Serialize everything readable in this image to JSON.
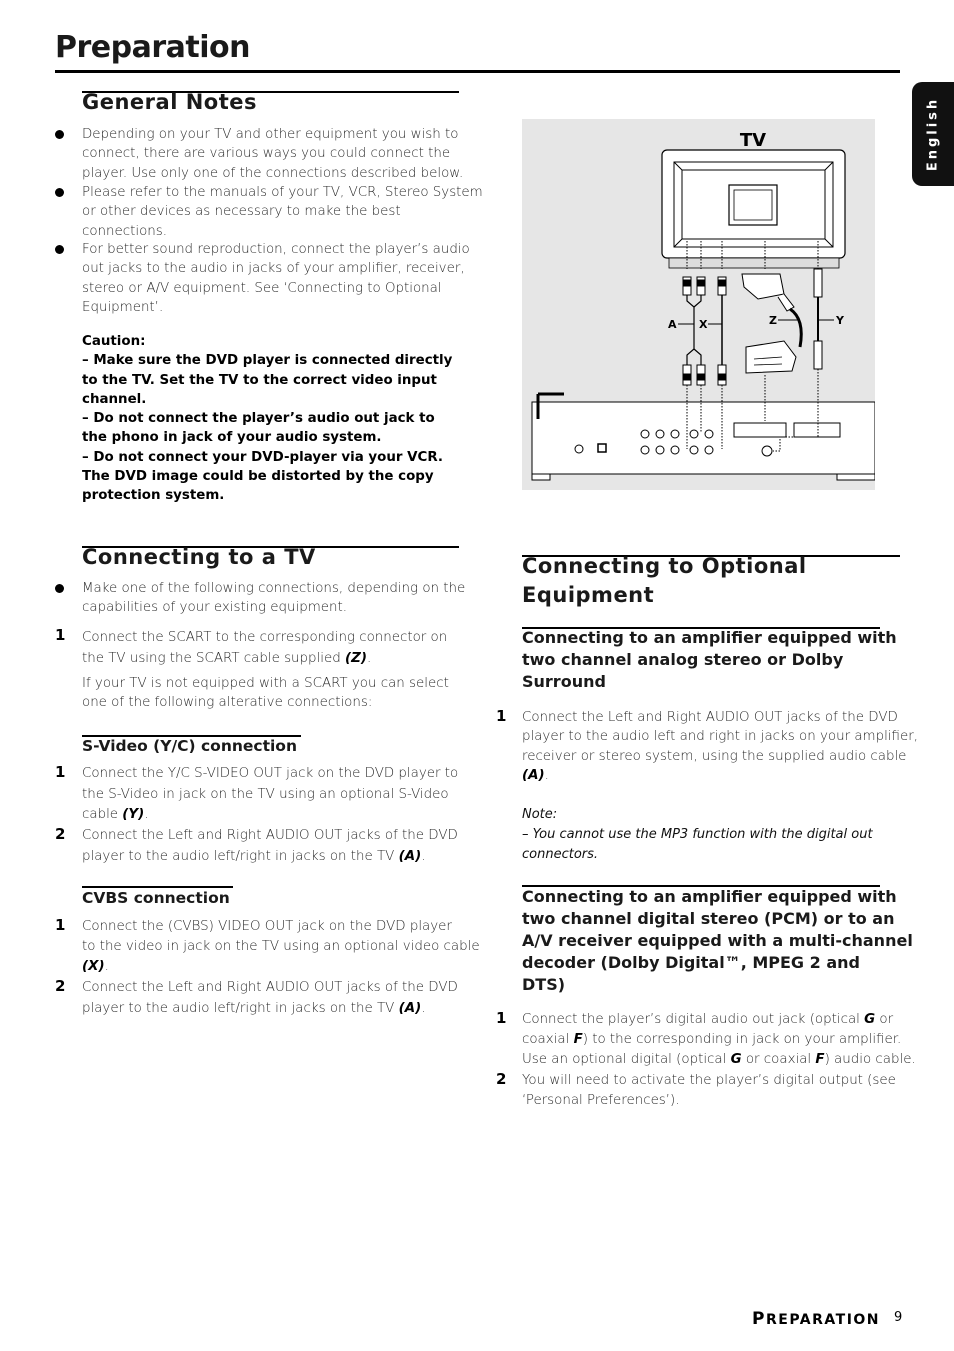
{
  "page": {
    "title": "Preparation",
    "language_tab": "English",
    "footer_section_first": "P",
    "footer_section_rest": "REPARATION",
    "page_number": "9"
  },
  "general_notes": {
    "heading": "General Notes",
    "bullets": [
      [
        "Depending on your TV and other equipment you wish to",
        "connect, there are various ways you could connect the",
        "player. Use only one of the connections described below."
      ],
      [
        "Please refer to the manuals of your TV, VCR, Stereo System",
        "or other devices as necessary to make the best",
        "connections."
      ],
      [
        "For better sound reproduction, connect the player’s audio",
        "out jacks to the audio in jacks of your amplifier, receiver,",
        "stereo or A/V equipment.  See ‘Connecting to Optional",
        "Equipment’."
      ]
    ],
    "caution_label": "Caution:",
    "caution_lines": [
      "– Make sure the DVD player is connected directly",
      "to the TV. Set the TV to the correct video input",
      "channel.",
      "–  Do not connect  the player’s audio out jack to",
      "the phono in jack of your audio system.",
      "–  Do not connect your DVD-player via your VCR.",
      "The DVD image could be distorted by the copy",
      "protection system."
    ]
  },
  "diagram": {
    "tv_label": "TV",
    "cable_labels": {
      "a": "A",
      "x": "X",
      "z": "Z",
      "y": "Y"
    }
  },
  "connecting_tv": {
    "heading": "Connecting to a TV",
    "bullet": [
      "Make one of the following connections, depending on the",
      "capabilities of your existing equipment."
    ],
    "step1_num": "1",
    "step1_lines": [
      "Connect the SCART to the corresponding connector on",
      "the TV using the SCART cable supplied "
    ],
    "step1_ref": "(Z)",
    "alt_lines": [
      "If your TV is not equipped with a SCART you can select",
      "one of the following alterative connections:"
    ],
    "svideo": {
      "heading": "S-Video (Y/C) connection",
      "step1_num": "1",
      "step1_lines": [
        "Connect the Y/C S-VIDEO OUT jack on the DVD player to",
        "the S-Video in jack on the TV using an optional S-Video",
        "cable "
      ],
      "step1_ref": "(Y)",
      "step2_num": "2",
      "step2_lines": [
        "Connect the Left and Right AUDIO OUT jacks of the DVD",
        "player to the audio left/right in jacks on the TV "
      ],
      "step2_ref": "(A)"
    },
    "cvbs": {
      "heading": "CVBS connection",
      "step1_num": "1",
      "step1_lines": [
        "Connect the (CVBS) VIDEO OUT jack on the DVD player",
        "to the video in jack on the TV using an optional video cable"
      ],
      "step1_ref": "(X)",
      "step2_num": "2",
      "step2_lines": [
        "Connect the Left and Right AUDIO OUT jacks of the DVD",
        "player to the audio left/right in jacks on the TV "
      ],
      "step2_ref": "(A)"
    }
  },
  "optional_equipment": {
    "heading_lines": [
      "Connecting to Optional",
      "Equipment"
    ],
    "analog": {
      "heading_lines": [
        "Connecting to an amplifier equipped with",
        "two channel analog  stereo or Dolby",
        "Surround"
      ],
      "step1_num": "1",
      "step1_lines": [
        "Connect the Left and Right AUDIO OUT jacks of the DVD",
        "player to the audio left and right in jacks on your amplifier,",
        "receiver or stereo system, using the supplied audio cable"
      ],
      "step1_ref": "(A)",
      "note_label": "Note:",
      "note_lines": [
        "–  You cannot use the MP3 function with the digital out",
        "connectors."
      ]
    },
    "digital": {
      "heading_lines": [
        "Connecting to an amplifier equipped with",
        "two channel digital stereo (PCM) or to an",
        "A/V receiver equipped with a multi-channel",
        "decoder (Dolby Digital™, MPEG 2 and",
        "DTS)"
      ],
      "step1_num": "1",
      "step1_parts": {
        "a": "Connect the player’s digital audio out jack (optical ",
        "g1": "G",
        "b": " or",
        "c": "coaxial ",
        "f1": "F",
        "d": ") to the corresponding in jack on your amplifier.",
        "e": "Use an optional digital (optical ",
        "g2": "G",
        "f": " or coaxial ",
        "f2": "F",
        "g": ") audio cable."
      },
      "step2_num": "2",
      "step2_lines": [
        "You will need to activate the player’s digital output (see",
        "‘Personal Preferences’)."
      ]
    }
  }
}
